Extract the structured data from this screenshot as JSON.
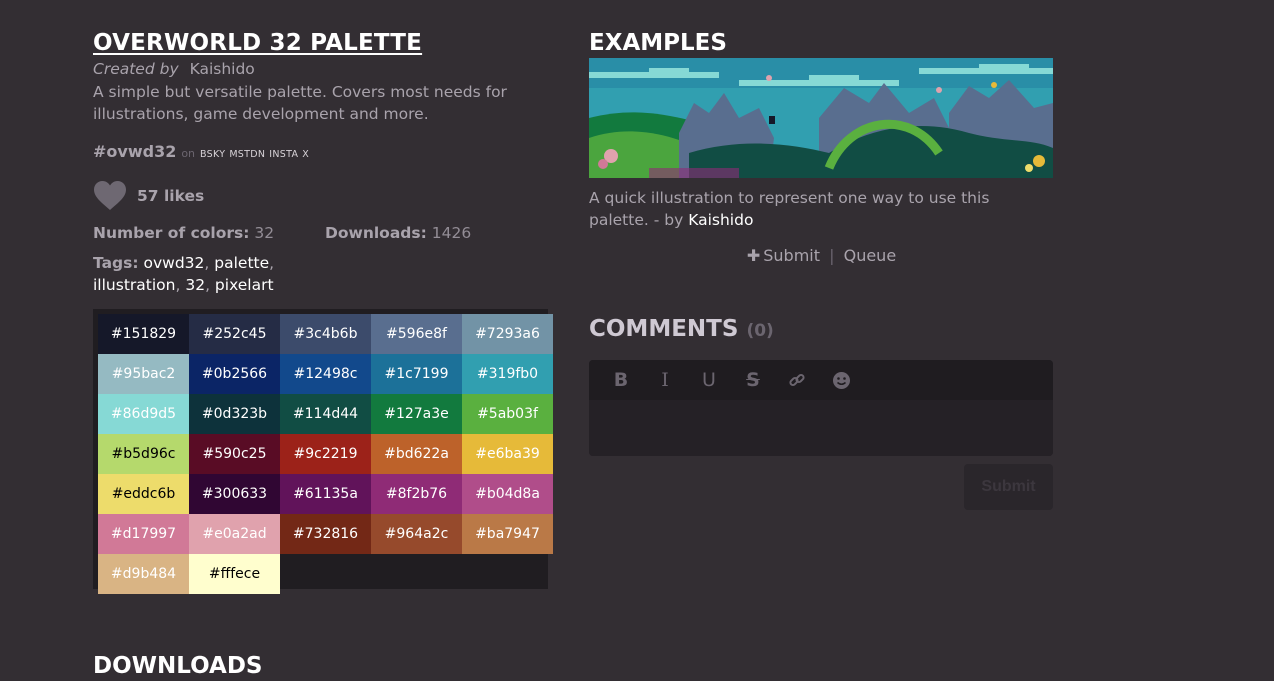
{
  "palette_info": {
    "title": "OVERWORLD 32 PALETTE",
    "created_label": "Created by",
    "author": "Kaishido",
    "description": "A simple but versatile palette. Covers most needs for illustrations, game development and more.",
    "hashtag": "#ovwd32",
    "on_label": "on",
    "social": [
      "BSKY",
      "MSTDN",
      "INSTA",
      "X"
    ],
    "likes": "57 likes",
    "colors_label": "Number of colors:",
    "colors_value": "32",
    "downloads_label": "Downloads:",
    "downloads_value": "1426",
    "tags_label": "Tags:",
    "tags": [
      "ovwd32",
      "palette",
      "illustration",
      "32",
      "pixelart"
    ]
  },
  "swatches": [
    {
      "hex": "#151829",
      "text": "#ffffff"
    },
    {
      "hex": "#252c45",
      "text": "#ffffff"
    },
    {
      "hex": "#3c4b6b",
      "text": "#ffffff"
    },
    {
      "hex": "#596e8f",
      "text": "#ffffff"
    },
    {
      "hex": "#7293a6",
      "text": "#ffffff"
    },
    {
      "hex": "#95bac2",
      "text": "#ffffff"
    },
    {
      "hex": "#0b2566",
      "text": "#ffffff"
    },
    {
      "hex": "#12498c",
      "text": "#ffffff"
    },
    {
      "hex": "#1c7199",
      "text": "#ffffff"
    },
    {
      "hex": "#319fb0",
      "text": "#ffffff"
    },
    {
      "hex": "#86d9d5",
      "text": "#ffffff"
    },
    {
      "hex": "#0d323b",
      "text": "#ffffff"
    },
    {
      "hex": "#114d44",
      "text": "#ffffff"
    },
    {
      "hex": "#127a3e",
      "text": "#ffffff"
    },
    {
      "hex": "#5ab03f",
      "text": "#ffffff"
    },
    {
      "hex": "#b5d96c",
      "text": "#000000"
    },
    {
      "hex": "#590c25",
      "text": "#ffffff"
    },
    {
      "hex": "#9c2219",
      "text": "#ffffff"
    },
    {
      "hex": "#bd622a",
      "text": "#ffffff"
    },
    {
      "hex": "#e6ba39",
      "text": "#ffffff"
    },
    {
      "hex": "#eddc6b",
      "text": "#000000"
    },
    {
      "hex": "#300633",
      "text": "#ffffff"
    },
    {
      "hex": "#61135a",
      "text": "#ffffff"
    },
    {
      "hex": "#8f2b76",
      "text": "#ffffff"
    },
    {
      "hex": "#b04d8a",
      "text": "#ffffff"
    },
    {
      "hex": "#d17997",
      "text": "#ffffff"
    },
    {
      "hex": "#e0a2ad",
      "text": "#ffffff"
    },
    {
      "hex": "#732816",
      "text": "#ffffff"
    },
    {
      "hex": "#964a2c",
      "text": "#ffffff"
    },
    {
      "hex": "#ba7947",
      "text": "#ffffff"
    },
    {
      "hex": "#d9b484",
      "text": "#ffffff"
    },
    {
      "hex": "#fffece",
      "text": "#000000"
    }
  ],
  "examples": {
    "title": "EXAMPLES",
    "caption": "A quick illustration to represent one way to use this palette. - by",
    "caption_author": "Kaishido",
    "submit_label": "Submit",
    "separator": "|",
    "queue_label": "Queue"
  },
  "comments": {
    "title": "COMMENTS",
    "count": "(0)",
    "toolbar": [
      "B",
      "I",
      "U",
      "S"
    ],
    "submit_button": "Submit"
  },
  "downloads_heading": "DOWNLOADS"
}
